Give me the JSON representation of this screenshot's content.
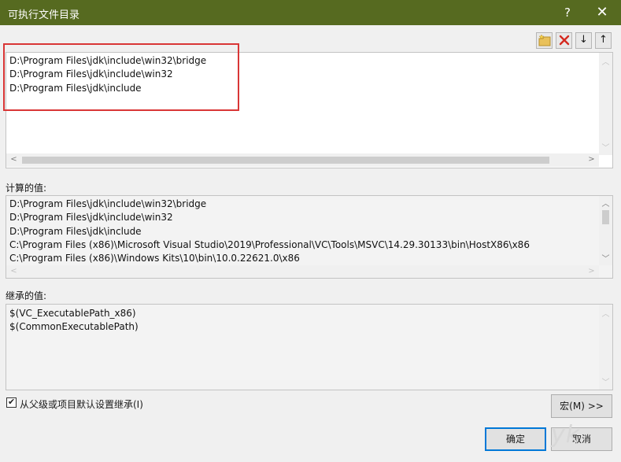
{
  "window": {
    "title": "可执行文件目录",
    "help": "?",
    "close": "✕"
  },
  "toolbar": {
    "new_folder": "new-folder-icon",
    "delete": "delete-icon",
    "move_down": "↓",
    "move_up": "↑"
  },
  "directories": [
    "D:\\Program Files\\jdk\\include\\win32\\bridge",
    "D:\\Program Files\\jdk\\include\\win32",
    "D:\\Program Files\\jdk\\include"
  ],
  "evaluated": {
    "label": "计算的值:",
    "lines": [
      "D:\\Program Files\\jdk\\include\\win32\\bridge",
      "D:\\Program Files\\jdk\\include\\win32",
      "D:\\Program Files\\jdk\\include",
      "C:\\Program Files (x86)\\Microsoft Visual Studio\\2019\\Professional\\VC\\Tools\\MSVC\\14.29.30133\\bin\\HostX86\\x86",
      "C:\\Program Files (x86)\\Windows Kits\\10\\bin\\10.0.22621.0\\x86"
    ]
  },
  "inherited": {
    "label": "继承的值:",
    "lines": [
      "$(VC_ExecutablePath_x86)",
      "$(CommonExecutablePath)"
    ]
  },
  "inherit_checkbox": {
    "label": "从父级或项目默认设置继承(I)",
    "checked": true
  },
  "buttons": {
    "macros": "宏(M) >>",
    "ok": "确定",
    "cancel": "取消"
  },
  "watermark": "yk"
}
